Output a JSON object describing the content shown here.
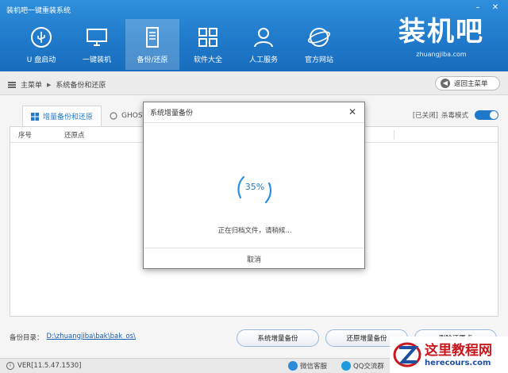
{
  "window": {
    "title": "装机吧一键重装系统",
    "min_icon": "minimize-icon",
    "close_icon": "close-icon"
  },
  "nav": [
    {
      "label": "U 盘启动",
      "icon": "usb-icon",
      "active": false
    },
    {
      "label": "一键装机",
      "icon": "monitor-icon",
      "active": false
    },
    {
      "label": "备份/还原",
      "icon": "backup-icon",
      "active": true
    },
    {
      "label": "软件大全",
      "icon": "grid-icon",
      "active": false
    },
    {
      "label": "人工服务",
      "icon": "support-person-icon",
      "active": false
    },
    {
      "label": "官方网站",
      "icon": "globe-icon",
      "active": false
    }
  ],
  "brand": {
    "name": "装机吧",
    "url": "zhuangjiba.com"
  },
  "breadcrumb": {
    "root": "主菜单",
    "current": "系统备份和还原",
    "back_label": "返回主菜单"
  },
  "tabs": [
    {
      "label": "增量备份和还原",
      "active": true
    },
    {
      "label": "GHOST",
      "active": false
    }
  ],
  "kill_mode": {
    "status": "[已关闭]",
    "label": "杀毒模式",
    "on": true
  },
  "table": {
    "columns": [
      "序号",
      "还原点"
    ]
  },
  "backup_dir": {
    "label": "备份目录：",
    "path": "D:\\zhuangjiba\\bak\\bak_os\\"
  },
  "actions": [
    "系统增量备份",
    "还原增量备份",
    "删除还原点"
  ],
  "status": {
    "version": "VER[11.5.47.1530]",
    "wechat": "微信客服",
    "qq": "QQ交流群"
  },
  "watermark": {
    "cn": "这里教程网",
    "url": "herecours.com"
  },
  "dialog": {
    "title": "系统增量备份",
    "progress_percent": 35,
    "progress_text": "35%",
    "message": "正在归档文件，请稍候...",
    "cancel_label": "取消"
  },
  "colors": {
    "accent": "#1f78c9",
    "header_top": "#2f8fdc",
    "link": "#1a5fb4",
    "watermark_red": "#c8181d"
  }
}
